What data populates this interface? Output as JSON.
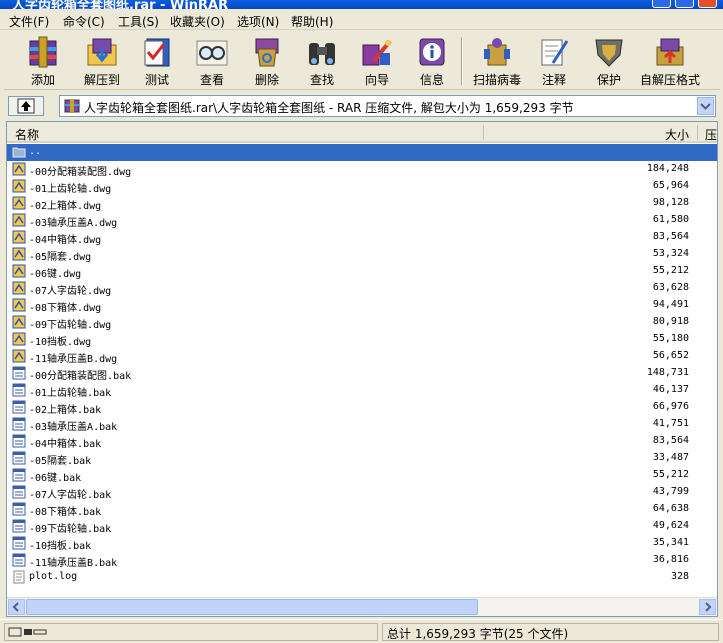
{
  "window": {
    "title": "人字齿轮箱全套图纸.rar - WinRAR"
  },
  "menu": [
    "文件(F)",
    "命令(C)",
    "工具(S)",
    "收藏夹(O)",
    "选项(N)",
    "帮助(H)"
  ],
  "toolbar": [
    {
      "label": "添加",
      "icon": "add-books-icon"
    },
    {
      "label": "解压到",
      "icon": "extract-folder-icon"
    },
    {
      "label": "测试",
      "icon": "test-check-icon"
    },
    {
      "label": "查看",
      "icon": "view-glasses-icon"
    },
    {
      "label": "删除",
      "icon": "delete-recycle-icon"
    },
    {
      "label": "查找",
      "icon": "find-binoculars-icon"
    },
    {
      "label": "向导",
      "icon": "wizard-icon"
    },
    {
      "label": "信息",
      "icon": "info-icon"
    },
    {
      "label": "扫描病毒",
      "icon": "scan-virus-icon"
    },
    {
      "label": "注释",
      "icon": "comment-pen-icon"
    },
    {
      "label": "保护",
      "icon": "protect-shield-icon"
    },
    {
      "label": "自解压格式",
      "icon": "sfx-archive-icon"
    }
  ],
  "address": {
    "path": "人字齿轮箱全套图纸.rar\\人字齿轮箱全套图纸 - RAR 压缩文件, 解包大小为 1,659,293 字节"
  },
  "columns": {
    "name": "名称",
    "size": "大小",
    "packed": "压"
  },
  "parent_row": {
    "name": ".."
  },
  "files": [
    {
      "name": "-00分配箱装配图.dwg",
      "size": "184,248",
      "type": "dwg"
    },
    {
      "name": "-01上齿轮轴.dwg",
      "size": "65,964",
      "type": "dwg"
    },
    {
      "name": "-02上箱体.dwg",
      "size": "98,128",
      "type": "dwg"
    },
    {
      "name": "-03轴承压盖A.dwg",
      "size": "61,580",
      "type": "dwg"
    },
    {
      "name": "-04中箱体.dwg",
      "size": "83,564",
      "type": "dwg"
    },
    {
      "name": "-05隔套.dwg",
      "size": "53,324",
      "type": "dwg"
    },
    {
      "name": "-06键.dwg",
      "size": "55,212",
      "type": "dwg"
    },
    {
      "name": "-07人字齿轮.dwg",
      "size": "63,628",
      "type": "dwg"
    },
    {
      "name": "-08下箱体.dwg",
      "size": "94,491",
      "type": "dwg"
    },
    {
      "name": "-09下齿轮轴.dwg",
      "size": "80,918",
      "type": "dwg"
    },
    {
      "name": "-10挡板.dwg",
      "size": "55,180",
      "type": "dwg"
    },
    {
      "name": "-11轴承压盖B.dwg",
      "size": "56,652",
      "type": "dwg"
    },
    {
      "name": "-00分配箱装配图.bak",
      "size": "148,731",
      "type": "bak"
    },
    {
      "name": "-01上齿轮轴.bak",
      "size": "46,137",
      "type": "bak"
    },
    {
      "name": "-02上箱体.bak",
      "size": "66,976",
      "type": "bak"
    },
    {
      "name": "-03轴承压盖A.bak",
      "size": "41,751",
      "type": "bak"
    },
    {
      "name": "-04中箱体.bak",
      "size": "83,564",
      "type": "bak"
    },
    {
      "name": "-05隔套.bak",
      "size": "33,487",
      "type": "bak"
    },
    {
      "name": "-06键.bak",
      "size": "55,212",
      "type": "bak"
    },
    {
      "name": "-07人字齿轮.bak",
      "size": "43,799",
      "type": "bak"
    },
    {
      "name": "-08下箱体.bak",
      "size": "64,638",
      "type": "bak"
    },
    {
      "name": "-09下齿轮轴.bak",
      "size": "49,624",
      "type": "bak"
    },
    {
      "name": "-10挡板.bak",
      "size": "35,341",
      "type": "bak"
    },
    {
      "name": "-11轴承压盖B.bak",
      "size": "36,816",
      "type": "bak"
    },
    {
      "name": "plot.log",
      "size": "328",
      "type": "log"
    }
  ],
  "status": {
    "left": "",
    "right": "总计 1,659,293 字节(25 个文件)"
  },
  "colors": {
    "selection": "#316ac5",
    "titlebar": "#0a5fe0",
    "dwg_icon": "#f2c94c",
    "bak_icon": "#3a5ea8"
  }
}
